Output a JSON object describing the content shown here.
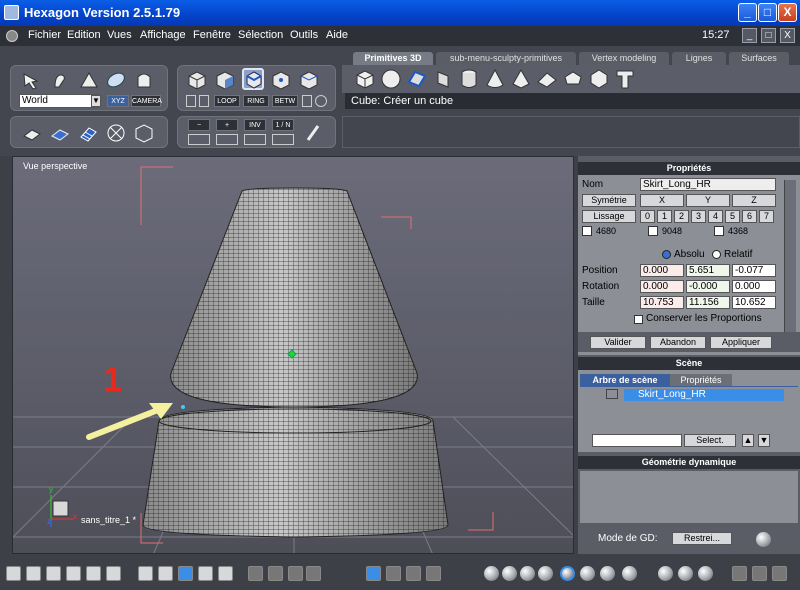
{
  "window": {
    "title": "Hexagon Version 2.5.1.79",
    "min": "_",
    "max": "□",
    "close": "X"
  },
  "menu": {
    "items": [
      "Fichier",
      "Edition",
      "Vues",
      "Affichage",
      "Fenêtre",
      "Sélection",
      "Outils",
      "Aide"
    ],
    "clock": "15:27",
    "btn_min": "_",
    "btn_max": "□",
    "btn_close": "X"
  },
  "tabs": [
    "Primitives 3D",
    "sub-menu-sculpty-primitives",
    "Vertex modeling",
    "Lignes",
    "Surfaces"
  ],
  "toolbar": {
    "space_select": "World",
    "xyz": "XYZ",
    "camera": "CAMERA",
    "loop": "LOOP",
    "ring": "RING",
    "betw": "BETW",
    "minus": "−",
    "plus": "+",
    "inv": "INV",
    "one_n": "1 / N"
  },
  "status_line": "Cube: Créer un cube",
  "viewport": {
    "label": "Vue perspective",
    "annotation_number": "1",
    "scene_name": "sans_titre_1 *",
    "axis_x": "x",
    "axis_y": "y",
    "axis_z": "z"
  },
  "properties": {
    "header": "Propriétés",
    "name_label": "Nom",
    "name_value": "Skirt_Long_HR",
    "symmetry_btn": "Symétrie",
    "sym_x": "X",
    "sym_y": "Y",
    "sym_z": "Z",
    "smooth_btn": "Lissage",
    "smooth_levels": [
      "0",
      "1",
      "2",
      "3",
      "4",
      "5",
      "6",
      "7"
    ],
    "counts": [
      "4680",
      "9048",
      "4368"
    ],
    "absolute": "Absolu",
    "relative": "Relatif",
    "position_label": "Position",
    "position": [
      "0.000",
      "5.651",
      "-0.077"
    ],
    "rotation_label": "Rotation",
    "rotation": [
      "0.000",
      "-0.000",
      "0.000"
    ],
    "size_label": "Taille",
    "size": [
      "10.753",
      "11.156",
      "10.652"
    ],
    "keep_prop": "Conserver les Proportions",
    "validate": "Valider",
    "cancel": "Abandon",
    "apply": "Appliquer"
  },
  "scene": {
    "header": "Scène",
    "tab_tree": "Arbre de scène",
    "tab_props": "Propriétés",
    "item": "Skirt_Long_HR",
    "select_btn": "Select."
  },
  "dyngeo": {
    "header": "Géométrie dynamique",
    "mode_label": "Mode de GD:",
    "mode_value": "Restrei..."
  },
  "colors": {
    "accent": "#3c5f9e",
    "title_blue": "#0a5ee6",
    "annotation_red": "#e62a1e",
    "arrow_yellow": "#f5f0a0"
  }
}
